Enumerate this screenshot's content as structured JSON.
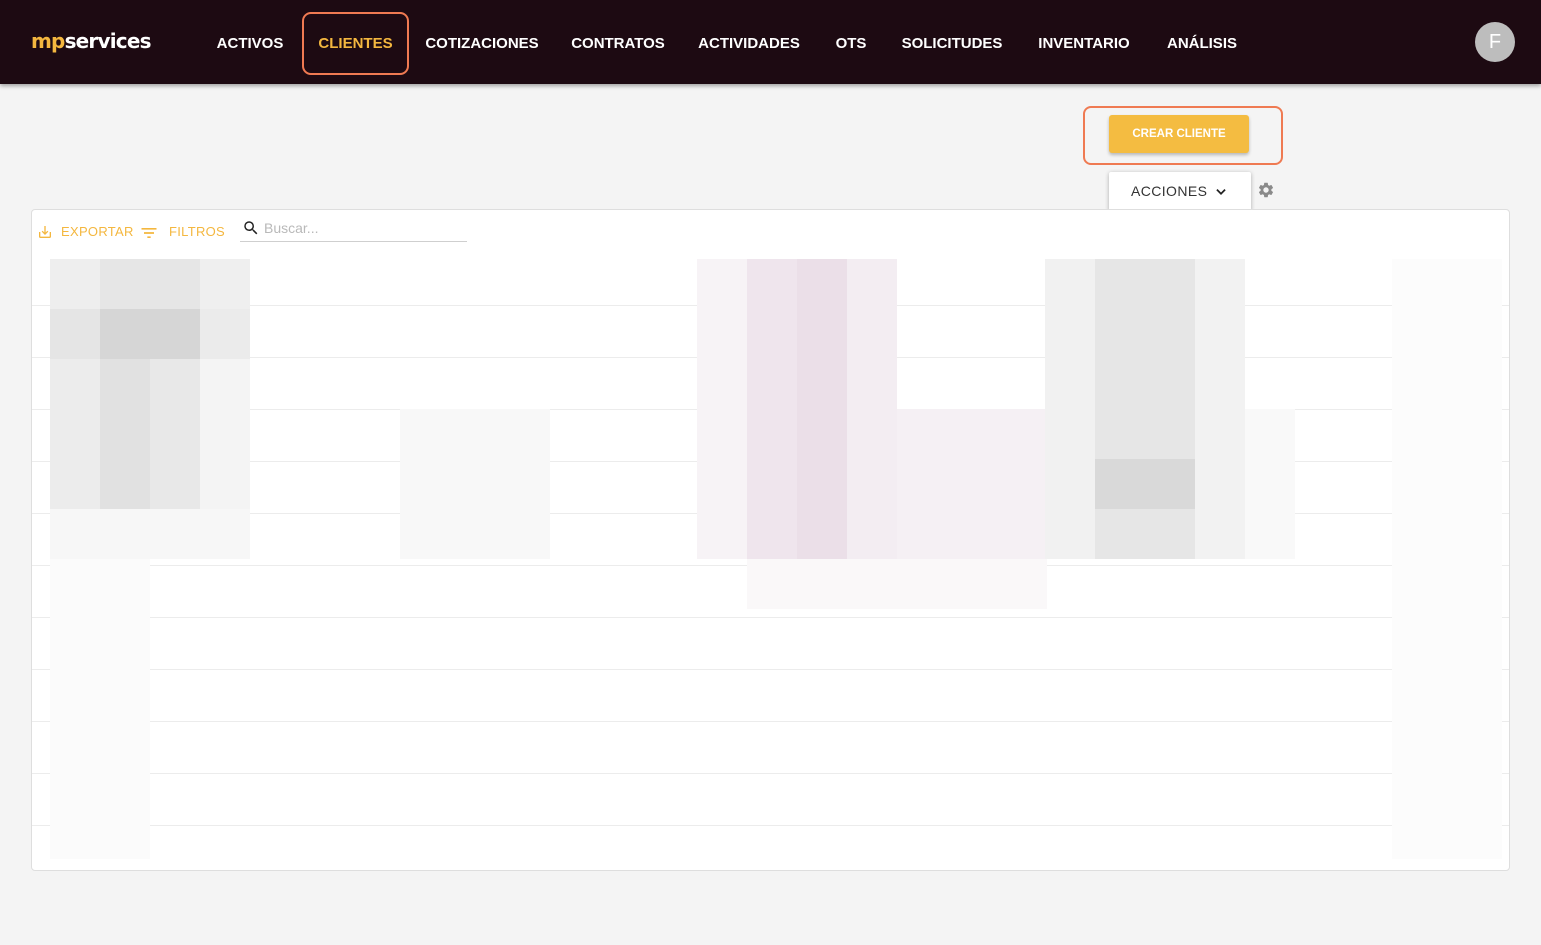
{
  "app": {
    "logo_prefix": "mp",
    "logo_suffix": "services",
    "avatar_initial": "F"
  },
  "nav": {
    "items": [
      {
        "label": "ACTIVOS",
        "active": false
      },
      {
        "label": "CLIENTES",
        "active": true
      },
      {
        "label": "COTIZACIONES",
        "active": false
      },
      {
        "label": "CONTRATOS",
        "active": false
      },
      {
        "label": "ACTIVIDADES",
        "active": false
      },
      {
        "label": "OTS",
        "active": false
      },
      {
        "label": "SOLICITUDES",
        "active": false
      },
      {
        "label": "INVENTARIO",
        "active": false
      },
      {
        "label": "ANÁLISIS",
        "active": false
      }
    ]
  },
  "actions": {
    "create_label": "CREAR CLIENTE",
    "menu_label": "ACCIONES"
  },
  "table": {
    "export_label": "EXPORTAR",
    "filters_label": "FILTROS",
    "search_placeholder": "Buscar..."
  },
  "colors": {
    "topbar": "#1d0a12",
    "accent": "#f4b73f",
    "highlight": "#ef7a52",
    "background": "#f4f4f4"
  },
  "icons": {
    "export": "download-icon",
    "filters": "filter-icon",
    "search": "search-icon",
    "menu": "chevron-down-icon",
    "settings": "gear-icon"
  }
}
